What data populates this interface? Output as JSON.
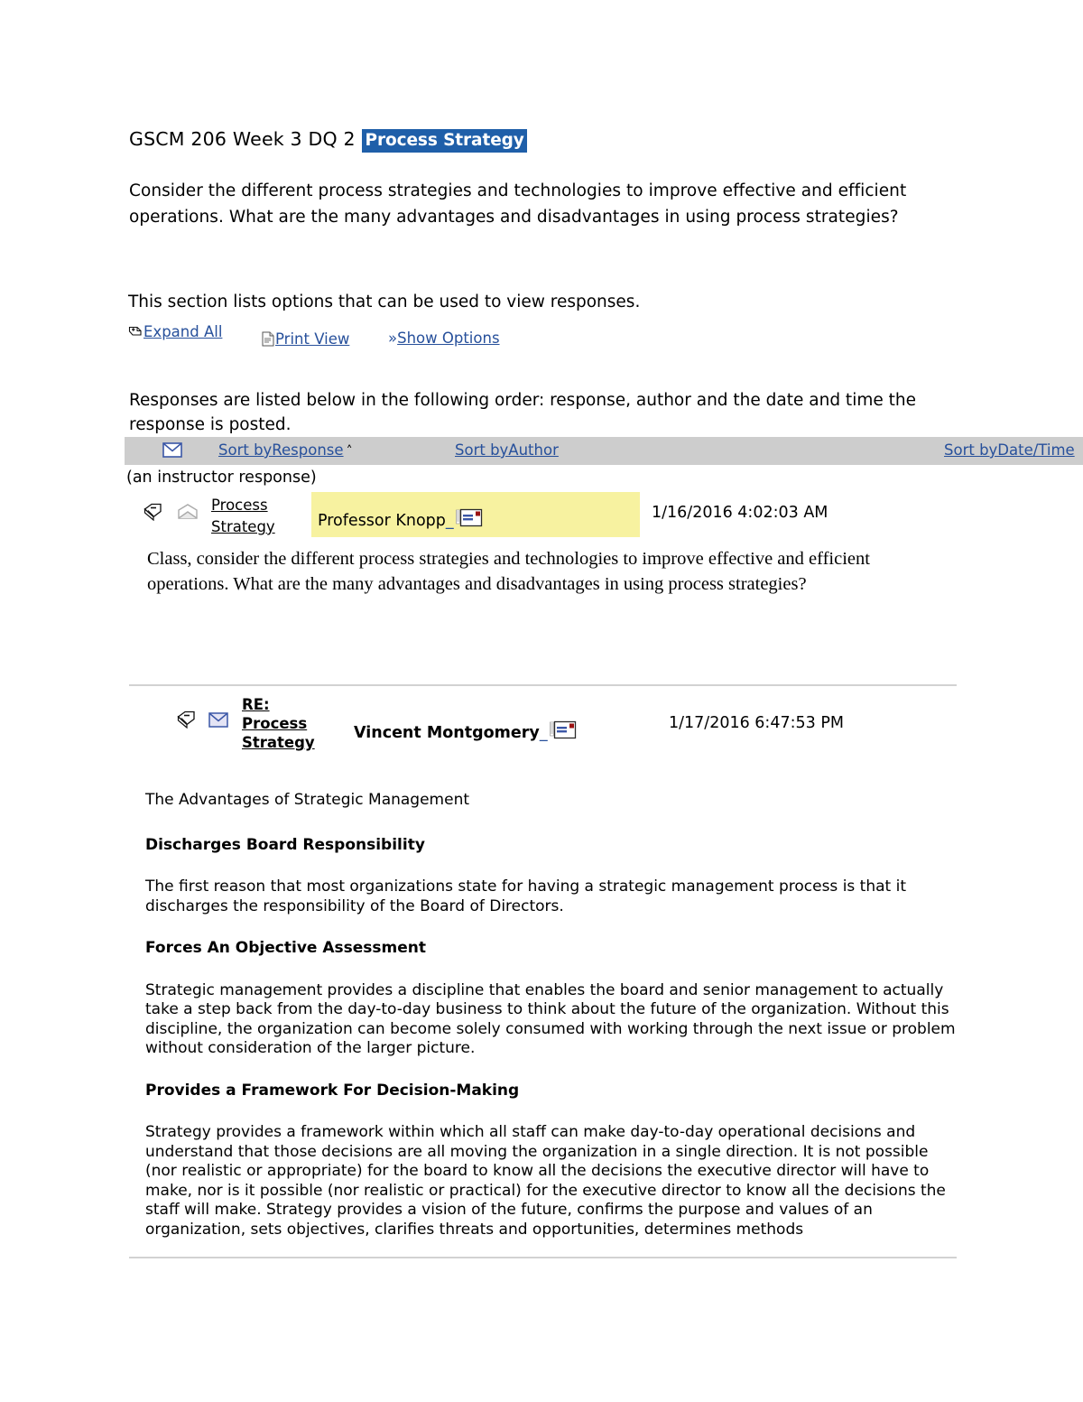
{
  "document": {
    "title_prefix": "GSCM 206 Week 3 DQ 2 ",
    "title_highlight": "Process Strategy",
    "highlight_color": "#1F5FA9",
    "intro_paragraph": "Consider the different process strategies and technologies to improve effective and efficient operations. What are the many advantages and disadvantages in using process strategies?"
  },
  "options": {
    "lead": "This section lists options that can be used to view responses.",
    "expand_all": "Expand All",
    "print_view": "Print View",
    "show_options": "Show Options",
    "show_options_marker": "»"
  },
  "responses_section": {
    "lead": "Responses are listed below in the following order: response, author and the date and time the response is posted.",
    "instructor_note": "(an instructor response)",
    "sort_bar": {
      "background": "#CDCDCD",
      "sort_by_response": "Sort byResponse",
      "sort_caret": "˄",
      "sort_by_author": "Sort byAuthor",
      "sort_by_date": "Sort byDate/Time"
    },
    "rows": [
      {
        "subject": "Process Strategy",
        "author": "Professor Knopp",
        "date": "1/16/2016 4:02:03 AM",
        "highlighted": true,
        "highlight_color": "#F7F2A0",
        "body": "Class, consider the different process strategies and technologies to improve effective and efficient operations. What are the many advantages and disadvantages in using process strategies?"
      },
      {
        "subject": "RE: Process Strategy",
        "author": "Vincent Montgomery",
        "date": "1/17/2016 6:47:53 PM",
        "highlighted": false
      }
    ]
  },
  "post_body": {
    "intro": "The Advantages of Strategic Management",
    "sections": [
      {
        "heading": "Discharges Board Responsibility",
        "paragraph": "The first reason that most organizations state for having a strategic management process is that it discharges the responsibility of the Board of Directors."
      },
      {
        "heading": "Forces An Objective Assessment",
        "paragraph": "Strategic management provides a discipline that enables the board and senior management to actually take a step back from the day-to-day business to think about the future of the organization. Without this discipline, the organization can become solely consumed with working through the next issue or problem without consideration of the larger picture."
      },
      {
        "heading": "Provides a Framework For Decision-Making",
        "paragraph": "Strategy provides a framework within which all staff can make day-to-day operational decisions and understand that those decisions are all moving the organization in a single direction. It is not possible (nor realistic or appropriate) for the board to know all the decisions the executive director will have to make, nor is it possible (nor realistic or practical) for the executive director to know all the decisions the staff will make. Strategy provides a vision of the future, confirms the purpose and values of an organization, sets objectives, clarifies threats and opportunities, determines methods"
      }
    ]
  }
}
